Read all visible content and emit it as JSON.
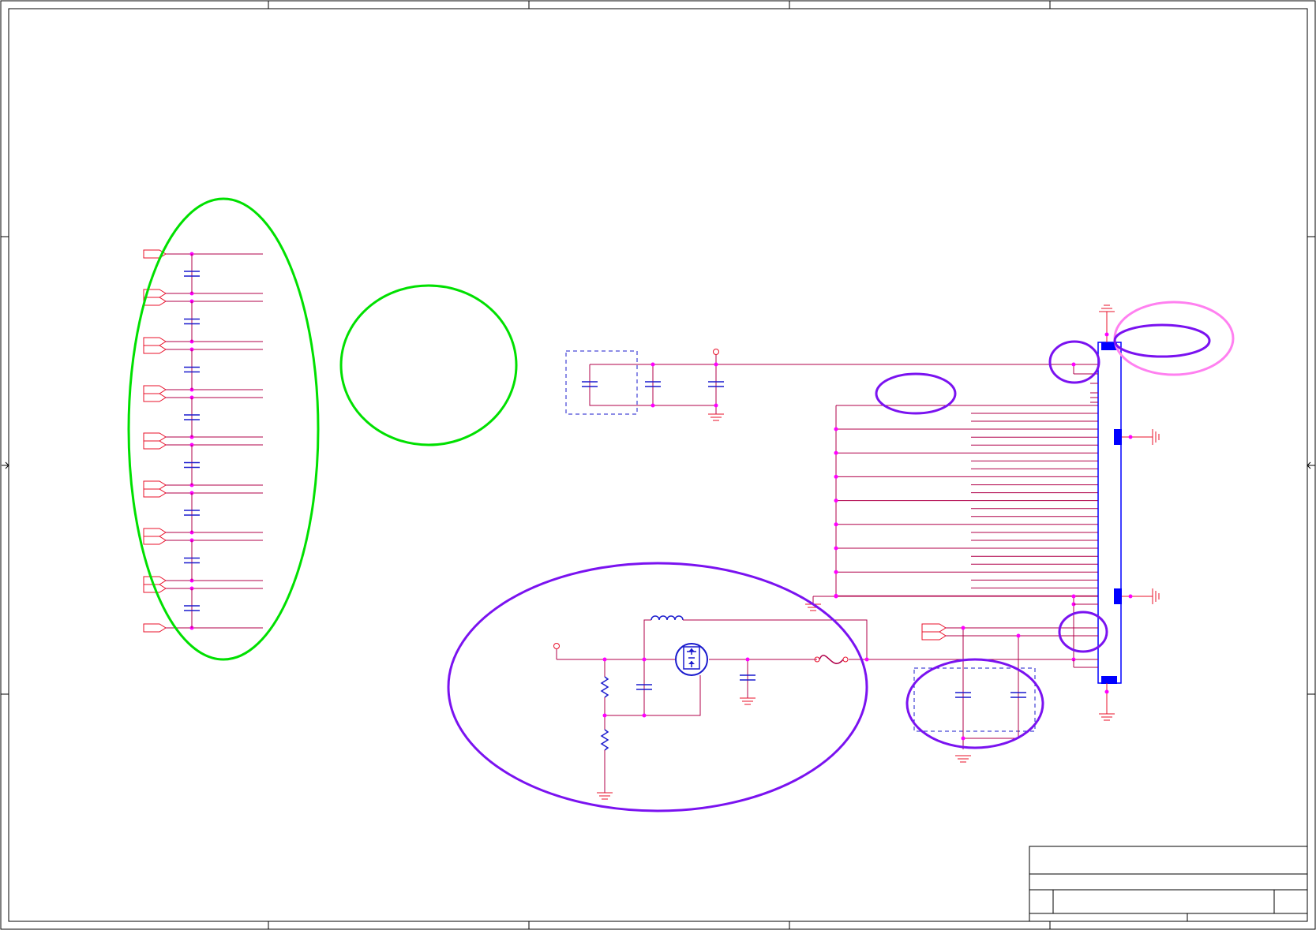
{
  "sheet": {
    "title_block_text": [],
    "notes": []
  },
  "colors": {
    "frame": "#000000",
    "wire": "#b0004a",
    "port": "#e8102a",
    "component": "#1a1acd",
    "junction": "#ff00ff",
    "ground": "#e8102a",
    "connector": "#0000ff",
    "highlight_green": "#00e000",
    "highlight_violet": "#7a12f0",
    "highlight_pink": "#ff80f0"
  },
  "highlights": [
    {
      "name": "input-filter-group",
      "color": "green"
    },
    {
      "name": "empty-annotation",
      "color": "green"
    },
    {
      "name": "power-switch-circuit",
      "color": "violet"
    },
    {
      "name": "connector-pin-1",
      "color": "violet"
    },
    {
      "name": "connector-top-pad",
      "color": "violet"
    },
    {
      "name": "connector-top-pad-outer",
      "color": "pink"
    },
    {
      "name": "signal-bus-start",
      "color": "violet"
    },
    {
      "name": "connector-supply-pins",
      "color": "violet"
    },
    {
      "name": "bypass-capacitors",
      "color": "violet"
    }
  ],
  "components": [
    "differential-ports",
    "filter-capacitors",
    "input-bypass-capacitors",
    "inductor",
    "mosfet-switch",
    "fuse",
    "resistor-divider",
    "output-capacitor",
    "connector-header",
    "ground-symbols"
  ]
}
